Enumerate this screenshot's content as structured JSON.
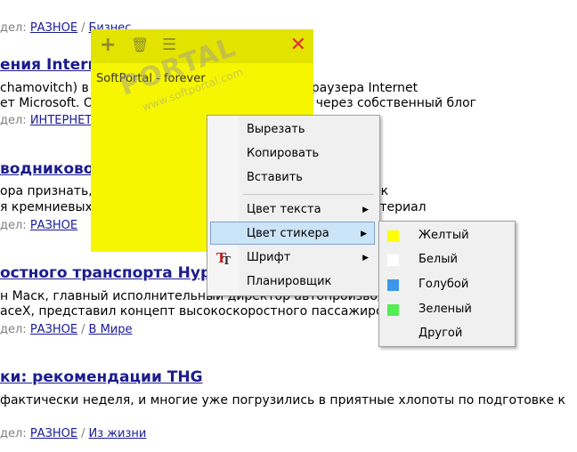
{
  "page": {
    "section_label": "дел:",
    "articles": [
      {
        "meta_top": {
          "category": "РАЗНОЕ",
          "sub": "Бизнес"
        },
        "headline": "ения Internet Explorer в Microsoft",
        "lines": [
          "chamovitch) в Microsoft, одной разработчиков браузера Internet",
          "ет Microsoft. Об этом он сообщил в публикации через собственный блог"
        ],
        "meta": {
          "category": "ИНТЕРНЕТ"
        }
      },
      {
        "headline": "водниковой электроники",
        "lines": [
          "ора признать, что индустрия практически приблизилась к",
          "я кремниевых технологий, пора переходить на новый материал"
        ],
        "meta": {
          "category": "РАЗНОЕ"
        }
      },
      {
        "headline": "остного транспорта Hyperloop",
        "lines": [
          "н Маск, главный исполнительный директор автопроизводителя",
          "aceX, представил концепт высокоскоростного пассажирского Hyperloop"
        ],
        "meta": {
          "category": "РАЗНОЕ",
          "sub": "В Мире"
        }
      },
      {
        "headline": "ки: рекомендации THG",
        "lines": [
          "фактически неделя, и многие уже погрузились в приятные хлопоты по подготовке к"
        ],
        "meta": {
          "category": "РАЗНОЕ",
          "sub": "Из жизни"
        }
      }
    ]
  },
  "sticker": {
    "color": "#f6f600",
    "text": "SoftPortal - forever",
    "icons": [
      "plus-icon",
      "trash-icon",
      "menu-icon",
      "close-icon"
    ],
    "add_glyph": "+",
    "trash_glyph": "🗑",
    "menu_glyph": "☰",
    "close_glyph": "✕"
  },
  "watermark": {
    "big": "PORTAL",
    "small": "www.softportal.com"
  },
  "context_menu": {
    "items": [
      {
        "label": "Вырезать"
      },
      {
        "label": "Копировать"
      },
      {
        "label": "Вставить"
      },
      {
        "label": "Цвет текста",
        "arrow": "▶"
      },
      {
        "label": "Цвет стикера",
        "arrow": "▶",
        "highlighted": true
      },
      {
        "label": "Шрифт",
        "arrow": "▶",
        "icon": "font-icon"
      },
      {
        "label": "Планировщик"
      }
    ]
  },
  "color_submenu": {
    "items": [
      {
        "label": "Желтый",
        "color": "#ffff00"
      },
      {
        "label": "Белый",
        "color": "#ffffff"
      },
      {
        "label": "Голубой",
        "color": "#3d97e8"
      },
      {
        "label": "Зеленый",
        "color": "#52ee52"
      },
      {
        "label": "Другой"
      }
    ]
  }
}
